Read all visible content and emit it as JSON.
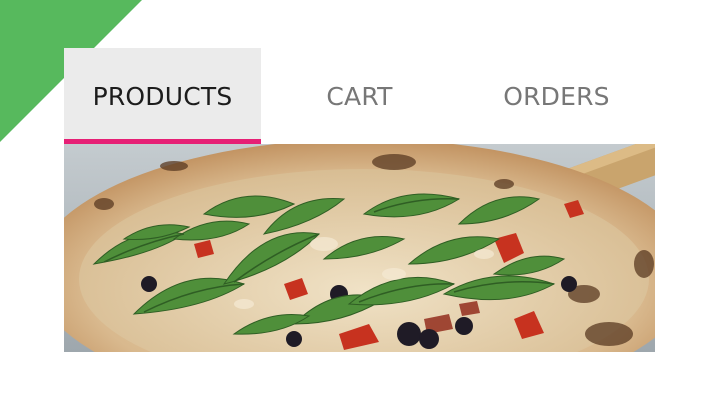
{
  "colors": {
    "accent_corner": "#57b95d",
    "active_tab_underline": "#e61f75",
    "active_tab_background": "#ebebeb"
  },
  "nav": {
    "tabs": [
      {
        "label": "PRODUCTS",
        "active": true
      },
      {
        "label": "CART",
        "active": false
      },
      {
        "label": "ORDERS",
        "active": false
      }
    ]
  },
  "hero": {
    "image_subject": "pizza-with-arugula"
  }
}
